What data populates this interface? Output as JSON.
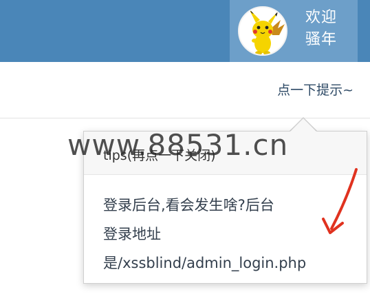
{
  "header": {
    "avatar_icon": "pikachu-avatar-icon",
    "welcome_line1": "欢迎",
    "welcome_line2": "骚年",
    "bar_color": "#4a86b8",
    "user_box_color": "#6d9fc9"
  },
  "tips_link": "点一下提示~",
  "popover": {
    "title": "tips(再点一下关闭)",
    "body_line1": "登录后台,看会发生啥?后台",
    "body_line2": "登录地址",
    "body_line3": "是/xssblind/admin_login.php"
  },
  "watermark": "www.88531.cn",
  "annotation": {
    "arrow_icon": "red-arrow-icon",
    "arrow_color": "#e0321f"
  }
}
